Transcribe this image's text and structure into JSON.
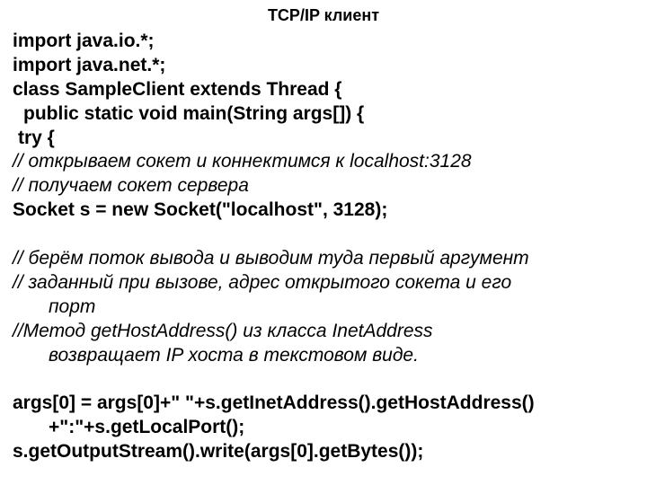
{
  "title": "TCP/IP клиент",
  "lines": {
    "l1": "import java.io.*;",
    "l2": "import java.net.*;",
    "l3": "class SampleClient extends Thread {",
    "l4": "public static void main(String args[]) {",
    "l5": "try {",
    "l6": "// открываем сокет и коннектимся к localhost:3128",
    "l7": "// получаем сокет сервера",
    "l8": "Socket s = new Socket(\"localhost\", 3128);",
    "l9": "// берём поток вывода и выводим туда первый аргумент",
    "l10a": "// заданный при вызове, адрес открытого сокета и его",
    "l10b": "порт",
    "l11a": "//Метод getHostAddress() из класса InetAddress",
    "l11b": "возвращает IP хоста в текстовом виде.",
    "l12a": "args[0] = args[0]+\" \"+s.getInetAddress().getHostAddress()",
    "l12b": "+\":\"+s.getLocalPort();",
    "l13": "s.getOutputStream().write(args[0].getBytes());"
  }
}
